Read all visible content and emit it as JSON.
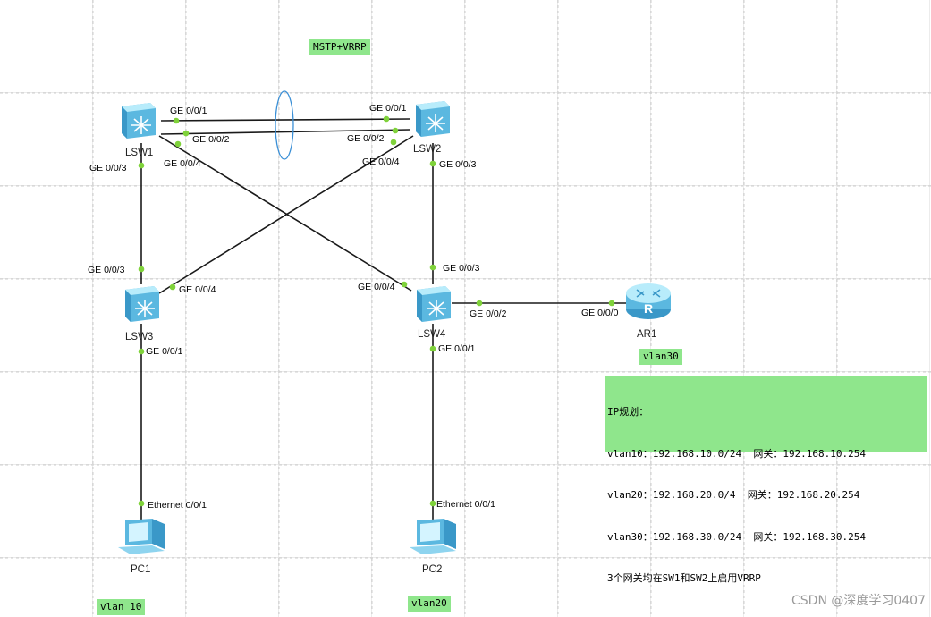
{
  "title_tag": "MSTP+VRRP",
  "devices": {
    "lsw1": "LSW1",
    "lsw2": "LSW2",
    "lsw3": "LSW3",
    "lsw4": "LSW4",
    "ar1": "AR1",
    "pc1": "PC1",
    "pc2": "PC2"
  },
  "ports": {
    "lsw1_g1": "GE 0/0/1",
    "lsw1_g2": "GE 0/0/2",
    "lsw1_g3": "GE 0/0/3",
    "lsw1_g4": "GE 0/0/4",
    "lsw2_g1": "GE 0/0/1",
    "lsw2_g2": "GE 0/0/2",
    "lsw2_g3": "GE 0/0/3",
    "lsw2_g4": "GE 0/0/4",
    "lsw3_g3": "GE 0/0/3",
    "lsw3_g4": "GE 0/0/4",
    "lsw3_g1": "GE 0/0/1",
    "lsw4_g3": "GE 0/0/3",
    "lsw4_g4": "GE 0/0/4",
    "lsw4_g2": "GE 0/0/2",
    "lsw4_g1": "GE 0/0/1",
    "ar1_g0": "GE 0/0/0",
    "pc1_eth": "Ethernet 0/0/1",
    "pc2_eth": "Ethernet 0/0/1"
  },
  "vlan_tags": {
    "ar1": "vlan30",
    "pc1": "vlan 10",
    "pc2": "vlan20"
  },
  "ip_plan": {
    "line1": "IP规划：",
    "line2": "vlan10：192.168.10.0/24  网关：192.168.10.254",
    "line3": "vlan20：192.168.20.0/4  网关：192.168.20.254",
    "line4": "vlan30：192.168.30.0/24  网关：192.168.30.254",
    "line5": "3个网关均在SW1和SW2上启用VRRP"
  },
  "watermark": "CSDN @深度学习0407",
  "colors": {
    "tag_bg": "#8fe68c",
    "port_dot": "#7fd23a",
    "switch_body": "#7fd2f0",
    "eth_trunk_ring": "#3a8fd6"
  }
}
